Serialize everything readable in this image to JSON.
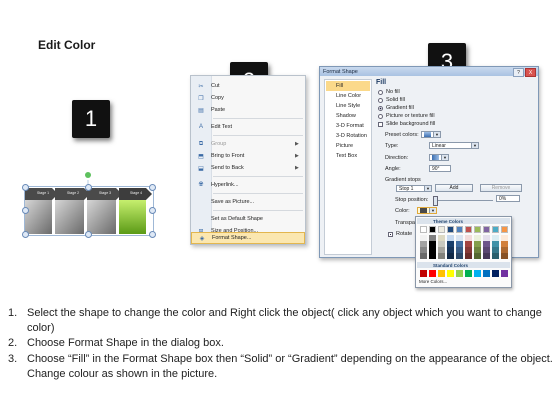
{
  "title": "Edit Color",
  "badges": [
    "1",
    "2",
    "3"
  ],
  "arrows": {
    "labels": [
      "Stage 1",
      "Stage 2",
      "Stage 3",
      "Stage 4"
    ],
    "colors": {
      "gray_dark": "#5c5c5c",
      "gray_light": "#b8b8b8",
      "green_light": "#b6e35a",
      "green_dark": "#5b9a16"
    }
  },
  "context_menu": {
    "items": [
      {
        "icon": "scissors-icon",
        "label": "Cut"
      },
      {
        "icon": "copy-icon",
        "label": "Copy"
      },
      {
        "icon": "paste-icon",
        "label": "Paste"
      },
      {
        "icon": "edit-text-icon",
        "label": "Edit Text"
      },
      {
        "icon": "group-icon",
        "label": "Group"
      },
      {
        "icon": "bring-front-icon",
        "label": "Bring to Front"
      },
      {
        "icon": "send-back-icon",
        "label": "Send to Back"
      },
      {
        "icon": "hyperlink-icon",
        "label": "Hyperlink..."
      },
      {
        "icon": "",
        "label": "Save as Picture..."
      },
      {
        "icon": "",
        "label": "Set as Default Shape"
      },
      {
        "icon": "size-icon",
        "label": "Size and Position..."
      },
      {
        "icon": "format-shape-icon",
        "label": "Format Shape..."
      }
    ]
  },
  "dialog": {
    "title": "Format Shape",
    "title_buttons": {
      "help": "?",
      "close": "X"
    },
    "categories": [
      "Fill",
      "Line Color",
      "Line Style",
      "Shadow",
      "3-D Format",
      "3-D Rotation",
      "Picture",
      "Text Box"
    ],
    "fill": {
      "heading": "Fill",
      "options": [
        "No fill",
        "Solid fill",
        "Gradient fill",
        "Picture or texture fill",
        "Slide background fill"
      ],
      "preset_colors_label": "Preset colors:",
      "type_label": "Type:",
      "type_value": "Linear",
      "direction_label": "Direction:",
      "angle_label": "Angle:",
      "angle_value": "90°",
      "gradient_stops_label": "Gradient stops",
      "stop_value": "Stop 1",
      "add_button": "Add",
      "remove_button": "Remove",
      "stop_position_label": "Stop position:",
      "stop_position_value": "0%",
      "color_label": "Color:",
      "transparency_label": "Transpa",
      "rotate_label": "Rotate"
    },
    "palette": {
      "theme_header": "Theme Colors",
      "standard_header": "Standard Colors",
      "more_colors": "More Colors..."
    }
  },
  "instructions": [
    {
      "num": "1.",
      "text": "Select the shape to change the color and Right click the object( click any object which you want to change color)"
    },
    {
      "num": "2.",
      "text": "Choose Format Shape in the dialog box."
    },
    {
      "num": "3.",
      "text": "Choose “Fill” in the Format Shape box then “Solid” or “Gradient” depending on the appearance of the object. Change colour as shown in the picture."
    }
  ]
}
